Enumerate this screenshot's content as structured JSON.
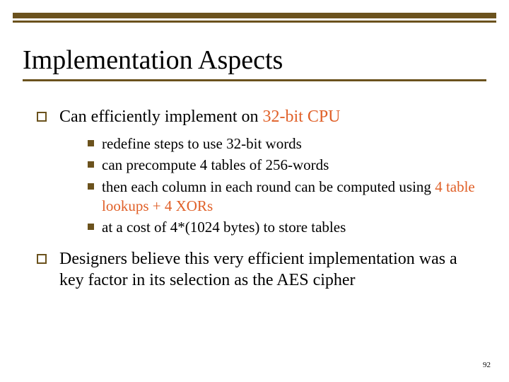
{
  "title": "Implementation Aspects",
  "bullets": {
    "p1_pre": "Can efficiently implement on ",
    "p1_accent": "32-bit CPU",
    "sub": {
      "s1": "redefine steps to use 32-bit words",
      "s2": "can precompute 4 tables of 256-words",
      "s3_pre": "then each column in each round can be computed using ",
      "s3_accent": "4 table lookups + 4 XORs",
      "s4": "at a cost of 4*(1024 bytes) to store tables"
    },
    "p2": "Designers believe this very efficient implementation was a key factor in its selection as the AES cipher"
  },
  "page_number": "92"
}
